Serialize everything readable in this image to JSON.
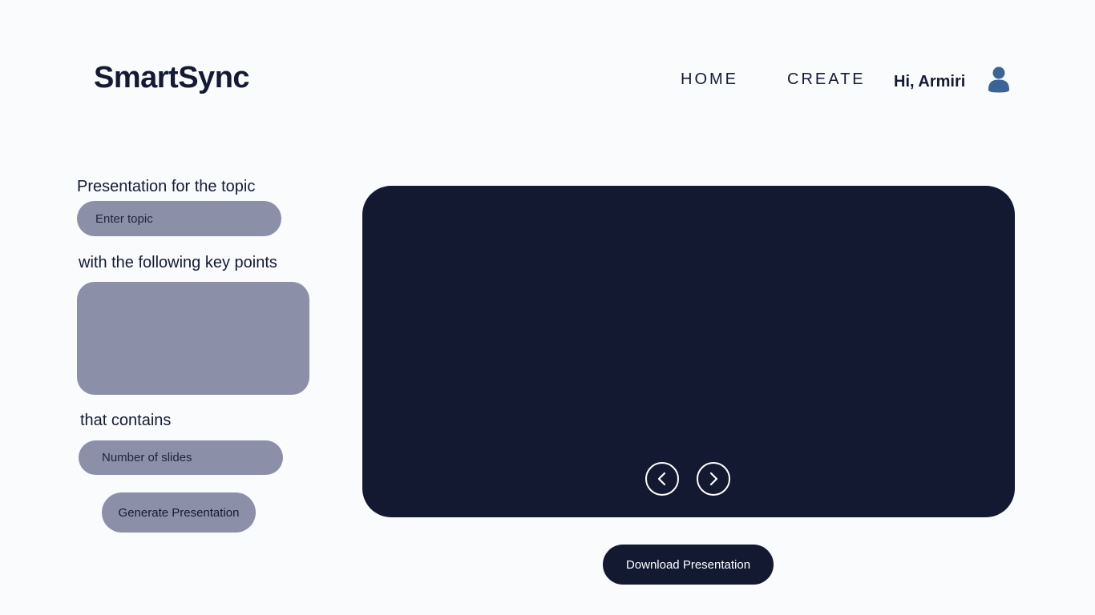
{
  "header": {
    "logo": "SmartSync",
    "nav": [
      {
        "label": "HOME"
      },
      {
        "label": "CREATE"
      }
    ],
    "greeting": "Hi, Armiri",
    "avatar_icon": "user-icon"
  },
  "form": {
    "topic_label": "Presentation for the topic",
    "topic_placeholder": "Enter topic",
    "topic_value": "",
    "keypoints_label": "with the following key points",
    "keypoints_value": "",
    "slides_label": "that contains",
    "slides_placeholder": "Number of slides",
    "slides_value": "",
    "generate_label": "Generate Presentation"
  },
  "preview": {
    "prev_icon": "chevron-left-icon",
    "next_icon": "chevron-right-icon",
    "download_label": "Download Presentation"
  },
  "colors": {
    "background": "#f9fbfd",
    "primary_dark": "#141932",
    "input_gray": "#8c8fa8",
    "avatar_blue": "#3a6493"
  }
}
